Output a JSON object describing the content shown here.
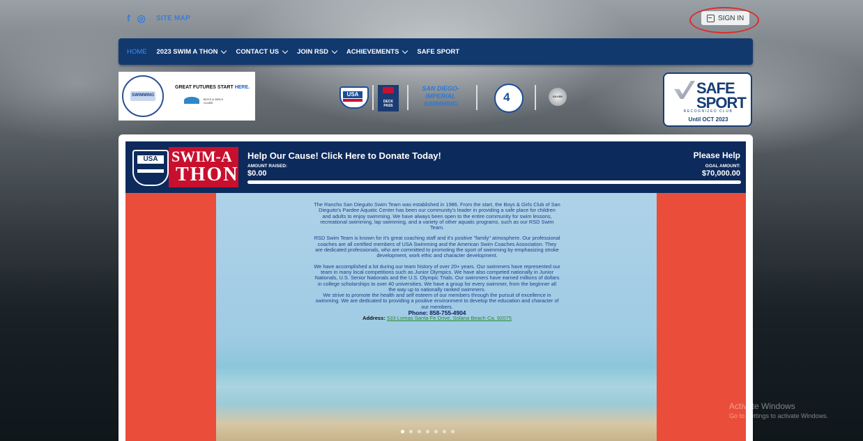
{
  "topbar": {
    "social_icons": [
      "facebook-icon",
      "instagram-icon"
    ],
    "facebook_glyph": "f",
    "instagram_glyph": "◎",
    "site_map": "SITE MAP",
    "sign_in": "SIGN IN"
  },
  "nav": {
    "items": [
      {
        "label": "HOME",
        "active": true,
        "dropdown": false
      },
      {
        "label": "2023 SWIM A THON",
        "dropdown": true
      },
      {
        "label": "CONTACT US",
        "dropdown": true
      },
      {
        "label": "JOIN RSD",
        "dropdown": true
      },
      {
        "label": "ACHIEVEMENTS",
        "dropdown": true
      },
      {
        "label": "SAFE SPORT",
        "dropdown": false
      }
    ]
  },
  "logos": {
    "club_seal_text": "SWIMMING",
    "great_futures_prefix": "GREAT FUTURES START ",
    "great_futures_emphasis": "HERE.",
    "boys_girls_club": "BOYS & GIRLS CLUBS",
    "usa_swimming": "USA",
    "deck_pass": "DECK PASS",
    "sdi_line1": "SAN DIEGO-",
    "sdi_line2": "IMPERIAL",
    "sdi_line3": "SWIMMING",
    "level_badge": "4",
    "silver_badge": "SILVER"
  },
  "safe_sport": {
    "line1": "SAFE",
    "line2": "SPORT",
    "recognized": "RECOGNIZED CLUB",
    "until": "Until OCT 2023"
  },
  "donation_banner": {
    "logo_usa": "USA",
    "logo_swim": "SWIM-A",
    "logo_thon": "THON",
    "title": "Help Our Cause! Click Here to Donate Today!",
    "amount_raised_label": "AMOUNT RAISED:",
    "amount_raised": "$0.00",
    "please_help": "Please Help",
    "goal_label": "GOAL AMOUNT:",
    "goal_amount": "$70,000.00",
    "progress_fraction": 0
  },
  "about": {
    "paragraph1": "The Rancho San Dieguito Swim Team was established in 1986. From the start, the Boys & Girls Club of San Dieguito's Pardee Aquatic Center has been our community's leader in providing a safe place for children and adults to enjoy swimming. We have always been open to the entire community for swim lessons, recreational swimming, lap swimming, and a variety of other aquatic programs, such as our RSD Swim Team.",
    "paragraph2": "RSD Swim Team is known for it's great coaching staff and it's positive \"family\" atmosphere. Our professional coaches are all certified members of USA Swimming and the American Swim Coaches Association. They are dedicated professionals, who are committed to promoting the sport of swimming by emphasizing stroke development, work ethic and character development.",
    "paragraph3": "We have accomplished a lot during our team history of over 20+ years. Our swimmers have represented our team in many local competitions such as Junior Olympics. We have also competed nationally in Junior Nationals, U.S. Senior Nationals and the U.S. Olympic Trials. Our swimmers have earned millions of dollars in college scholarships to over 40 universities. We have a group for every swimmer, from the beginner all the way up to nationally ranked swimmers.",
    "paragraph4": "We strive to promote the health and self esteem of our members through the pursuit of excellence in swimming. We are dedicated to providing a positive environment to develop the education and character of our members.",
    "phone": "Phone: 858-755-4904",
    "address_label": "Address: ",
    "address_link": "533 Lomas Santa Fe Drive, Solana Beach Ca. 92075"
  },
  "carousel": {
    "slide_count": 7,
    "active_index": 0
  },
  "os_watermark": {
    "line1": "Activate Windows",
    "line2": "Go to Settings to activate Windows."
  }
}
